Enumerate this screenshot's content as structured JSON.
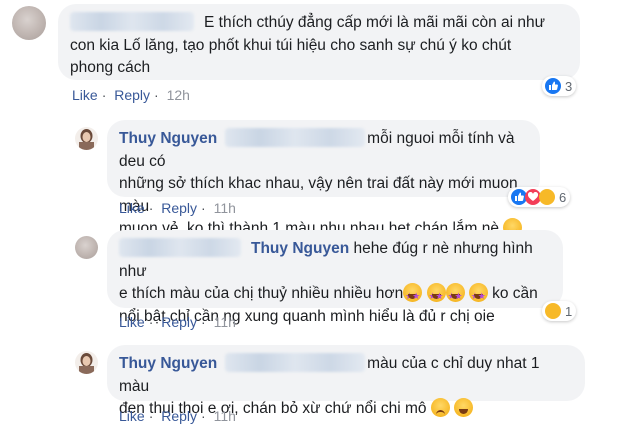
{
  "comments": [
    {
      "author": "",
      "text_lines": [
        "E thích cthúy đẳng cấp mới là mãi mãi còn ai như",
        "con kia Lố lăng, tạo phốt khui túi hiệu cho sanh sự chú ý ko chút",
        "phong cách"
      ],
      "like": "Like",
      "reply": "Reply",
      "time": "12h",
      "reaction_count": "3"
    },
    {
      "author": "Thuy Nguyen",
      "text_lines": [
        "mỗi nguoi mỗi tính và deu có",
        "những sở thích khac nhau, vậy nên trai đất này mới muon màu",
        "muon vẻ, ko thì thành 1 màu nhu nhau het chán lắm nè"
      ],
      "like": "Like",
      "reply": "Reply",
      "time": "11h",
      "reaction_count": "6"
    },
    {
      "author": "Thuy Nguyen",
      "text_lines": [
        "hehe đúg r nè nhưng hình như",
        "e thích màu của chị thuỷ nhiều nhiều hơn",
        "ko cần",
        "nổi bật chỉ cần ng xung quanh mình hiểu là đủ r chị oie"
      ],
      "like": "Like",
      "reply": "Reply",
      "time": "11h",
      "reaction_count": "1"
    },
    {
      "author": "Thuy Nguyen",
      "text_lines": [
        "màu của c chỉ duy nhat 1 màu",
        "đen thui thoi e ơi, chán bỏ xừ chứ nổi chi mô"
      ],
      "like": "Like",
      "reply": "Reply",
      "time": "11h"
    }
  ],
  "separator": "·",
  "icons": [
    "like-reaction-icon",
    "love-reaction-icon",
    "haha-reaction-icon",
    "star-struck-emoji",
    "smile-emoji",
    "frown-emoji"
  ],
  "colors": {
    "name": "#385898",
    "bubble": "#f2f3f5",
    "like_blue": "#1877f2"
  }
}
